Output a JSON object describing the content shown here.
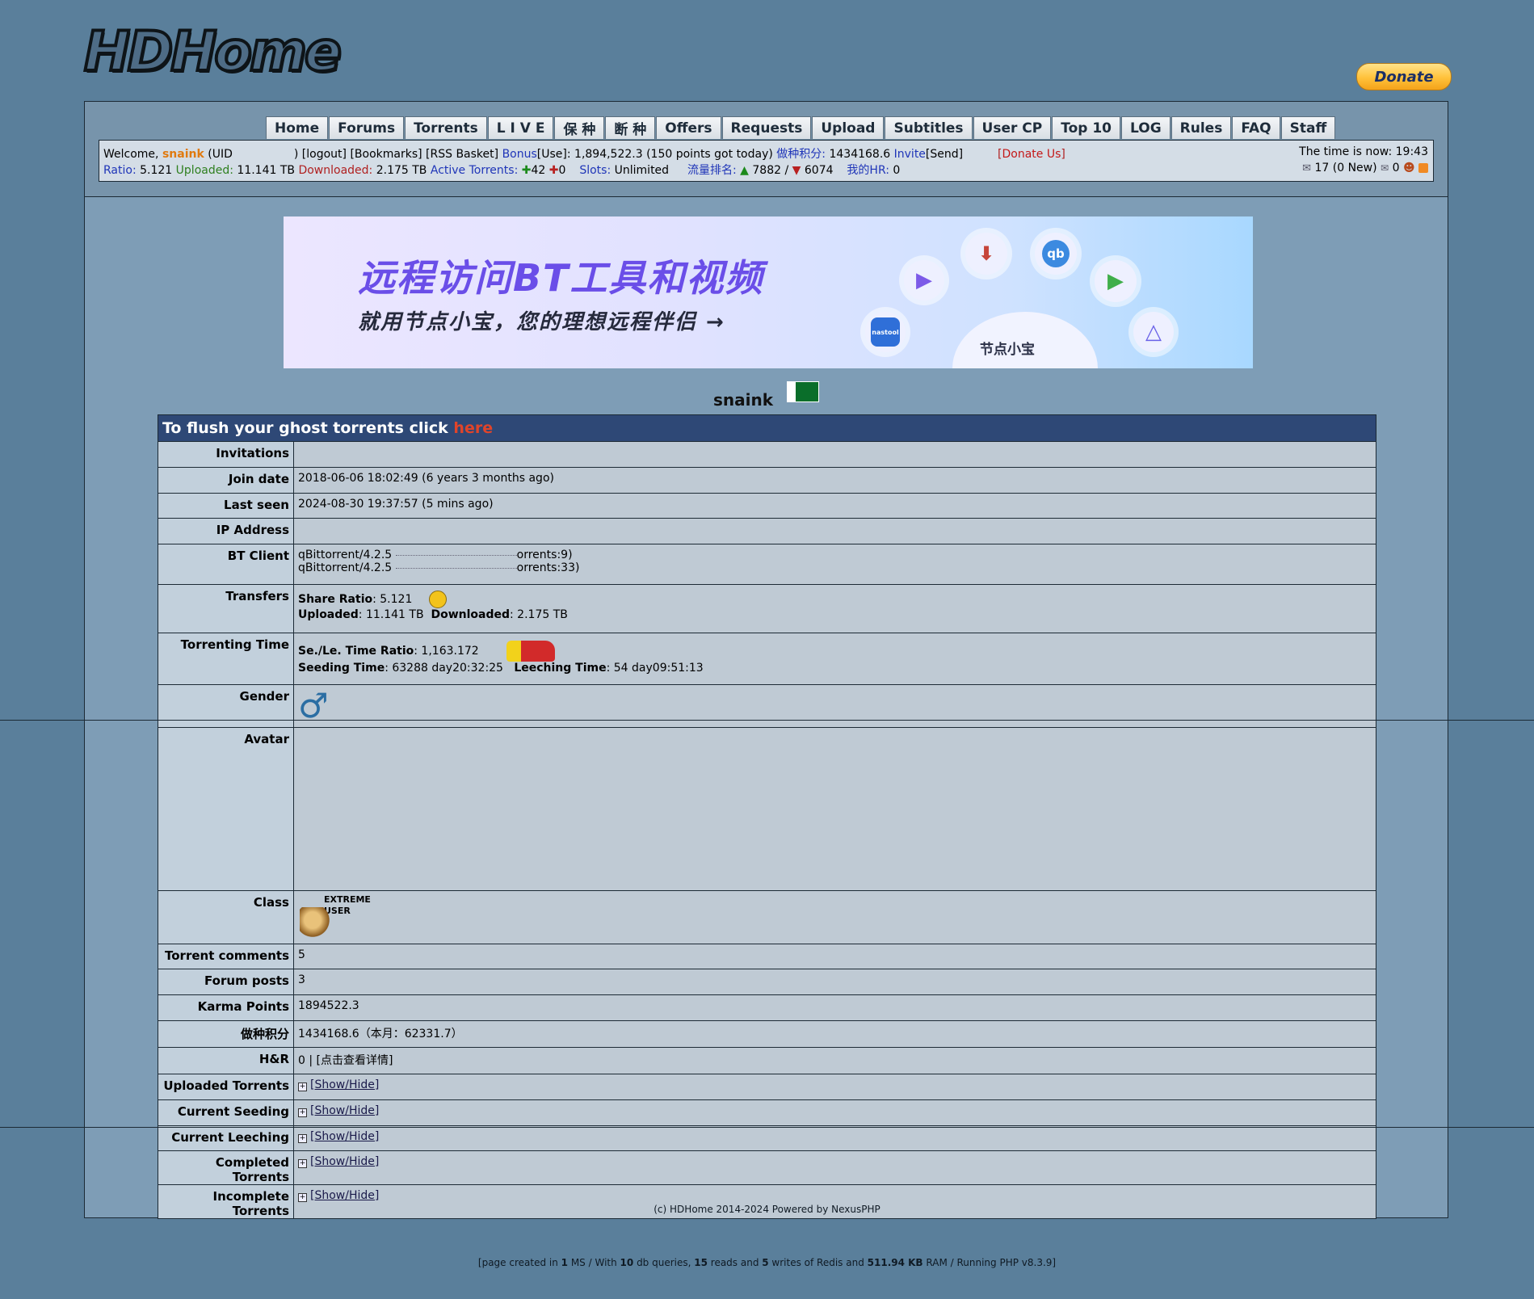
{
  "logo_text": "HDHome",
  "donate_button": "Donate",
  "nav": [
    "Home",
    "Forums",
    "Torrents",
    "L I V E",
    "保  种",
    "断  种",
    "Offers",
    "Requests",
    "Upload",
    "Subtitles",
    "User CP",
    "Top 10",
    "LOG",
    "Rules",
    "FAQ",
    "Staff"
  ],
  "infobar": {
    "welcome": "Welcome,",
    "username": "snaink",
    "uid_label": "(UID",
    "uid_close": ")",
    "logout": "[logout]",
    "bookmarks": "[Bookmarks]",
    "rss": "[RSS Basket]",
    "bonus_label": "Bonus",
    "bonus_use": "[Use]:",
    "bonus_value": "1,894,522.3 (150 points got today)",
    "seed_points_label": "做种积分:",
    "seed_points_value": "1434168.6",
    "invite_label": "Invite",
    "send": "[Send]",
    "donate_us_open": "[",
    "donate_us": "Donate Us",
    "donate_us_close": "]",
    "ratio_label": "Ratio:",
    "ratio_value": "5.121",
    "uploaded_label": "Uploaded:",
    "uploaded_value": "11.141 TB",
    "downloaded_label": "Downloaded:",
    "downloaded_value": "2.175 TB",
    "active_label": "Active Torrents:",
    "active_up": "42",
    "active_down": "0",
    "slots_label": "Slots:",
    "slots_value": "Unlimited",
    "traffic_rank_label": "流量排名:",
    "rank_up": "7882",
    "rank_sep": "/",
    "rank_down": "6074",
    "hr_label": "我的HR:",
    "hr_value": "0",
    "time_label": "The time is now: 19:43",
    "messages": "17 (0 New)",
    "friends_count": "0"
  },
  "banner": {
    "title": "远程访问BT工具和视频",
    "subtitle": "就用节点小宝，您的理想远程伴侣 →",
    "center_label": "节点小宝",
    "icons": [
      "nastool",
      "qb"
    ]
  },
  "profile": {
    "username": "snaink",
    "flush_text": "To flush your ghost torrents click",
    "flush_link": "here",
    "rows": {
      "invitations": {
        "label": "Invitations",
        "value": ""
      },
      "join_date": {
        "label": "Join date",
        "value": "2018-06-06 18:02:49 (6 years 3 months ago)"
      },
      "last_seen": {
        "label": "Last seen",
        "value": "2024-08-30 19:37:57 (5 mins ago)"
      },
      "ip": {
        "label": "IP Address",
        "value": ""
      },
      "bt_client": {
        "label": "BT Client",
        "line1_client": "qBittorrent/4.2.5",
        "line1_tail": "orrents:9)",
        "line2_client": "qBittorrent/4.2.5",
        "line2_tail": "orrents:33)"
      },
      "transfers": {
        "label": "Transfers",
        "share_ratio_label": "Share Ratio",
        "share_ratio_value": ": 5.121",
        "uploaded_label": "Uploaded",
        "uploaded_value": ": 11.141 TB",
        "downloaded_label": "Downloaded",
        "downloaded_value": ": 2.175 TB"
      },
      "torrenting_time": {
        "label": "Torrenting Time",
        "ratio_label": "Se./Le. Time Ratio",
        "ratio_value": ": 1,163.172",
        "seeding_label": "Seeding Time",
        "seeding_value": ": 63288 day20:32:25",
        "leeching_label": "Leeching Time",
        "leeching_value": ": 54 day09:51:13"
      },
      "gender": {
        "label": "Gender",
        "symbol": "♂"
      },
      "avatar": {
        "label": "Avatar"
      },
      "class": {
        "label": "Class",
        "badge_line1": "EXTREME",
        "badge_line2": "USER"
      },
      "torrent_comments": {
        "label": "Torrent comments",
        "value": "5"
      },
      "forum_posts": {
        "label": "Forum posts",
        "value": "3"
      },
      "karma": {
        "label": "Karma Points",
        "value": "1894522.3"
      },
      "seed_points": {
        "label": "做种积分",
        "value": "1434168.6（本月：62331.7）"
      },
      "hr": {
        "label": "H&R",
        "value": "0 | [点击查看详情]"
      },
      "uploaded_torrents": {
        "label": "Uploaded Torrents",
        "link": "[Show/Hide]"
      },
      "current_seeding": {
        "label": "Current Seeding",
        "link": "[Show/Hide]"
      },
      "current_leeching": {
        "label": "Current Leeching",
        "link": "[Show/Hide]"
      },
      "completed_torrents": {
        "label": "Completed Torrents",
        "link": "[Show/Hide]"
      },
      "incomplete_torrents": {
        "label": "Incomplete Torrents",
        "link": "[Show/Hide]"
      }
    }
  },
  "footer": {
    "copyright": "(c) HDHome 2014-2024 Powered by NexusPHP",
    "stats_1": "[page created in ",
    "ms": "1",
    "stats_2": " MS / With ",
    "queries": "10",
    "stats_3": " db queries, ",
    "reads": "15",
    "stats_4": " reads and ",
    "writes": "5",
    "stats_5": " writes of Redis and ",
    "ram": "511.94 KB",
    "stats_6": " RAM / Running PHP v8.3.9]"
  },
  "colors": {
    "background": "#5a7f9b",
    "table_header": "#2e4876",
    "link_blue": "#1f35b8",
    "accent_orange": "#e07a10"
  }
}
